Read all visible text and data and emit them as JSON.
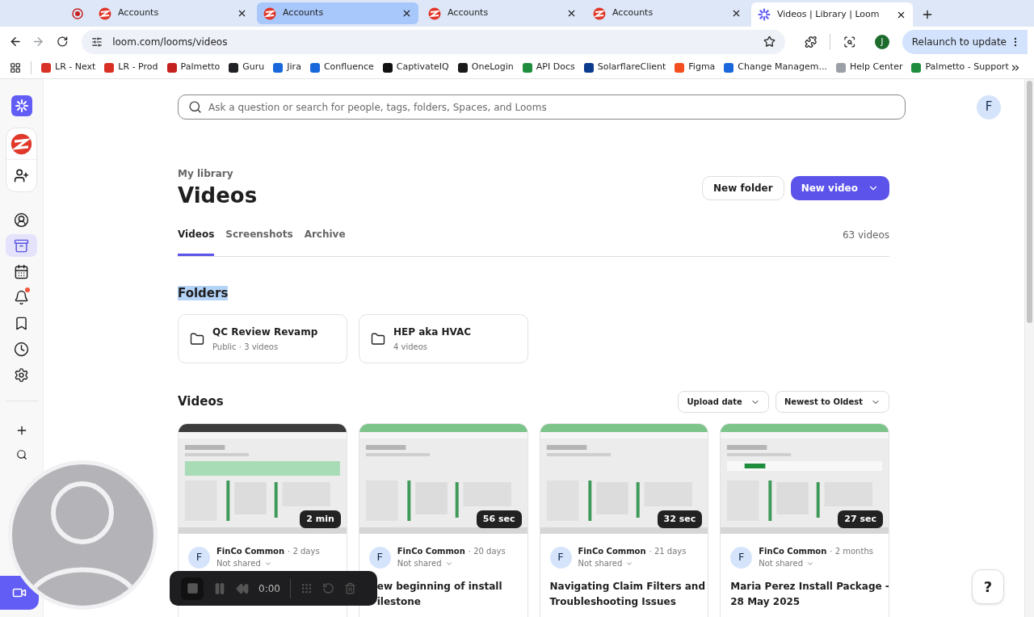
{
  "browser": {
    "tabs": [
      {
        "title": "Accounts",
        "kind": "accounts",
        "selected": false,
        "highlighted": false
      },
      {
        "title": "Accounts",
        "kind": "accounts",
        "selected": false,
        "highlighted": true
      },
      {
        "title": "Accounts",
        "kind": "accounts",
        "selected": false,
        "highlighted": false
      },
      {
        "title": "Accounts",
        "kind": "accounts",
        "selected": false,
        "highlighted": false
      },
      {
        "title": "Videos | Library | Loom",
        "kind": "loom",
        "selected": true,
        "highlighted": false
      }
    ],
    "url": "loom.com/looms/videos",
    "profile_initial": "J",
    "update_button": "Relaunch to update",
    "bookmarks": [
      {
        "label": "LR - Next",
        "color": "#d93025"
      },
      {
        "label": "LR - Prod",
        "color": "#d93025"
      },
      {
        "label": "Palmetto",
        "color": "#c5221f"
      },
      {
        "label": "Guru",
        "color": "#202124"
      },
      {
        "label": "Jira",
        "color": "#1868db"
      },
      {
        "label": "Confluence",
        "color": "#1868db"
      },
      {
        "label": "CaptivateIQ",
        "color": "#111111"
      },
      {
        "label": "OneLogin",
        "color": "#1a1a1a"
      },
      {
        "label": "API Docs",
        "color": "#1e8e3e"
      },
      {
        "label": "SolarflareClient",
        "color": "#0b3b8c"
      },
      {
        "label": "Figma",
        "color": "#f24e1e"
      },
      {
        "label": "Change Managem...",
        "color": "#1868db"
      },
      {
        "label": "Help Center",
        "color": "#9aa0a6"
      },
      {
        "label": "Palmetto - Support",
        "color": "#1e8e3e"
      }
    ]
  },
  "sidebar": {
    "items": [
      {
        "kind": "profile",
        "selected": false,
        "badge": false
      },
      {
        "kind": "library",
        "selected": true,
        "badge": false
      },
      {
        "kind": "calendar",
        "selected": false,
        "badge": false
      },
      {
        "kind": "notifications",
        "selected": false,
        "badge": true
      },
      {
        "kind": "bookmarks",
        "selected": false,
        "badge": false
      },
      {
        "kind": "history",
        "selected": false,
        "badge": false
      },
      {
        "kind": "settings",
        "selected": false,
        "badge": false
      }
    ]
  },
  "search": {
    "placeholder": "Ask a question or search for people, tags, folders, Spaces, and Looms"
  },
  "user_avatar": "F",
  "header": {
    "breadcrumb": "My library",
    "title": "Videos",
    "new_folder": "New folder",
    "new_video": "New video"
  },
  "tabs": [
    {
      "label": "Videos",
      "selected": true
    },
    {
      "label": "Screenshots",
      "selected": false
    },
    {
      "label": "Archive",
      "selected": false
    }
  ],
  "video_count": "63 videos",
  "folders_heading": {
    "text": "Folders",
    "highlighted": true
  },
  "folders": [
    {
      "name": "QC Review Revamp",
      "meta": "Public · 3 videos"
    },
    {
      "name": "HEP aka HVAC",
      "meta": "4 videos"
    }
  ],
  "videos_heading": "Videos",
  "sort": [
    "Upload date",
    "Newest to Oldest"
  ],
  "videos": [
    {
      "duration": "2 min",
      "initial": "F",
      "owner": "FinCo Common",
      "age": "· 2 days",
      "sharing": "Not shared"
    },
    {
      "duration": "56 sec",
      "initial": "F",
      "owner": "FinCo Common",
      "age": "· 20 days",
      "sharing": "Not shared",
      "title_lines": [
        "ew beginning of install",
        "ilestone"
      ]
    },
    {
      "duration": "32 sec",
      "initial": "F",
      "owner": "FinCo Common",
      "age": "· 21 days",
      "sharing": "Not shared",
      "title_lines": [
        "Navigating Claim Filters and",
        "Troubleshooting Issues"
      ]
    },
    {
      "duration": "27 sec",
      "initial": "F",
      "owner": "FinCo Common",
      "age": "· 2 months",
      "sharing": "Not shared",
      "title_lines": [
        "Maria Perez Install Package -",
        "28 May 2025"
      ]
    }
  ],
  "recorder": {
    "time": "0:00"
  },
  "help": "?"
}
